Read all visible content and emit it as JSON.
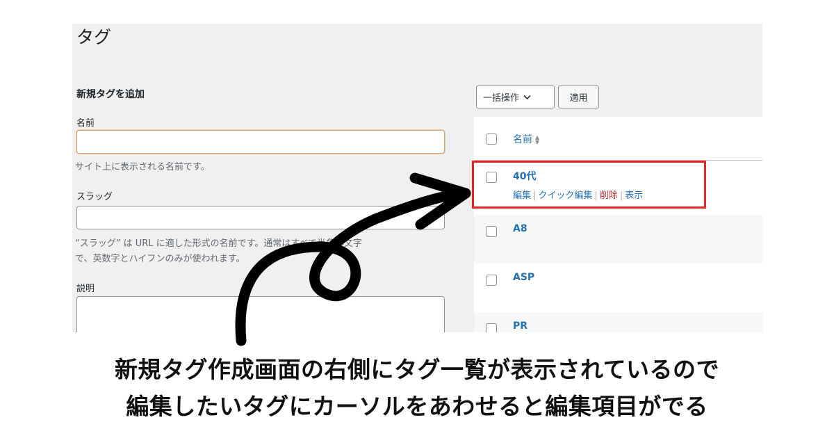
{
  "page": {
    "heading": "タグ",
    "add_section_title": "新規タグを追加"
  },
  "form": {
    "name_label": "名前",
    "name_value": "",
    "name_help": "サイト上に表示される名前です。",
    "slug_label": "スラッグ",
    "slug_value": "",
    "slug_help_line1": "“スラッグ” は URL に適した形式の名前です。通常はすべて半角小文字",
    "slug_help_line2": "で、英数字とハイフンのみが使われます。",
    "description_label": "説明",
    "description_value": ""
  },
  "list": {
    "bulk_action_label": "一括操作",
    "apply_label": "適用",
    "column_name": "名前",
    "tags": [
      {
        "name": "40代"
      },
      {
        "name": "A8"
      },
      {
        "name": "ASP"
      },
      {
        "name": "PR"
      }
    ],
    "row_actions": {
      "edit": "編集",
      "quick_edit": "クイック編集",
      "delete": "削除",
      "view": "表示"
    }
  },
  "caption": {
    "line1": "新規タグ作成画面の右側にタグ一覧が表示されているので",
    "line2": "編集したいタグにカーソルをあわせると編集項目がでる"
  },
  "colors": {
    "highlight": "#e32424",
    "link": "#2271b1",
    "delete": "#b32d2e",
    "arrow": "#000000"
  }
}
